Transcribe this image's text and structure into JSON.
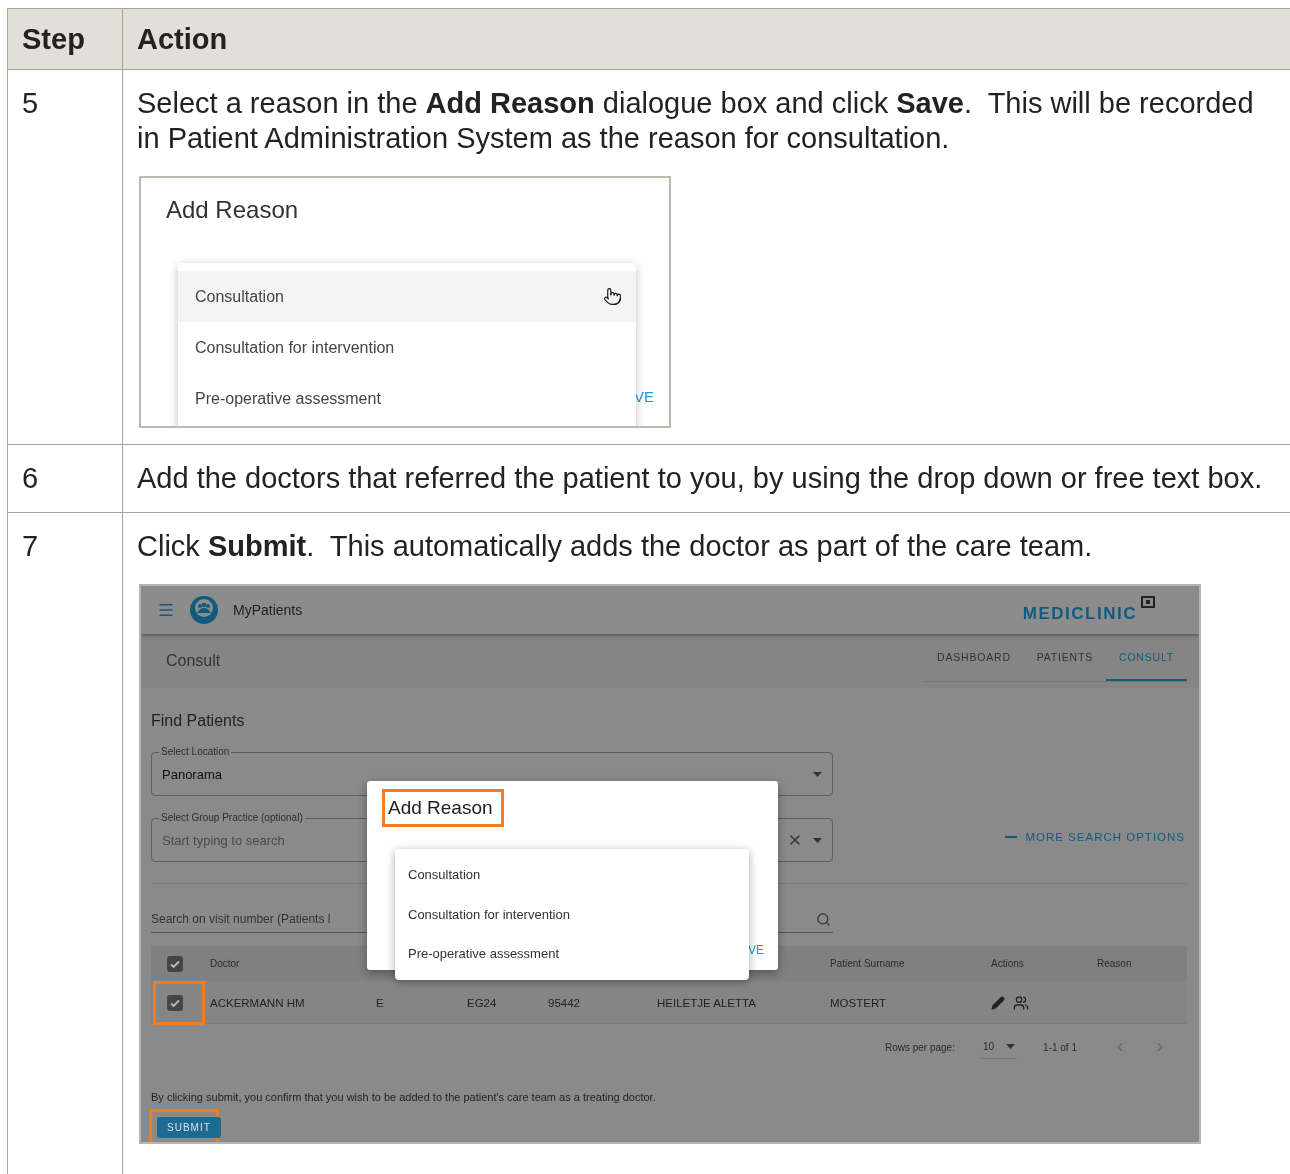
{
  "table": {
    "columns": [
      "Step",
      "Action"
    ],
    "rows": [
      {
        "step": "5",
        "text": "Select a reason in the **Add Reason** dialogue box and click **Save**.  This will be recorded in Patient Administration System as the reason for consultation.",
        "figure": {
          "kind": "reason_dialog",
          "title": "Add Reason",
          "options": [
            {
              "label": "Consultation",
              "highlighted": true
            },
            {
              "label": "Consultation for intervention",
              "highlighted": false
            },
            {
              "label": "Pre-operative assessment",
              "highlighted": false
            }
          ],
          "save_fragment": "VE"
        }
      },
      {
        "step": "6",
        "text": "Add the doctors that referred the patient to you, by using the drop down or free text box."
      },
      {
        "step": "7",
        "text": "Click **Submit**.  This automatically adds the doctor as part of the care team.",
        "figure": {
          "kind": "app_screen",
          "app_name": "MyPatients",
          "brand": "MEDICLINIC",
          "page_title": "Consult",
          "tabs": [
            {
              "label": "DASHBOARD",
              "selected": false
            },
            {
              "label": "PATIENTS",
              "selected": false
            },
            {
              "label": "CONSULT",
              "selected": true
            }
          ],
          "section_title": "Find Patients",
          "location_field": {
            "label": "Select Location",
            "value": "Panorama"
          },
          "practice_field": {
            "label": "Select Group Practice (optional)",
            "placeholder": "Start typing to search"
          },
          "more_search": "MORE SEARCH OPTIONS",
          "search_field": {
            "placeholder": "Search on visit number (Patients l"
          },
          "results": {
            "header_checked": true,
            "columns": [
              "Doctor",
              "",
              "",
              "",
              "",
              "Patient Surname",
              "Actions",
              "Reason"
            ],
            "rows": [
              {
                "checked": true,
                "highlighted": true,
                "cells": [
                  "ACKERMANN HM",
                  "E",
                  "EG24",
                  "95442",
                  "HEILETJE ALETTA",
                  "MOSTERT"
                ]
              }
            ]
          },
          "pagination": {
            "label": "Rows per page:",
            "value": "10",
            "range": "1-1 of 1"
          },
          "notice": "By clicking submit, you confirm that you wish to be added to the patient's care team as a treating doctor.",
          "submit": {
            "label": "SUBMIT",
            "highlighted": true
          },
          "dialog": {
            "title": "Add Reason",
            "title_highlighted": true,
            "options": [
              "Consultation",
              "Consultation for intervention",
              "Pre-operative assessment"
            ],
            "save_fragment": "VE"
          }
        }
      }
    ]
  }
}
